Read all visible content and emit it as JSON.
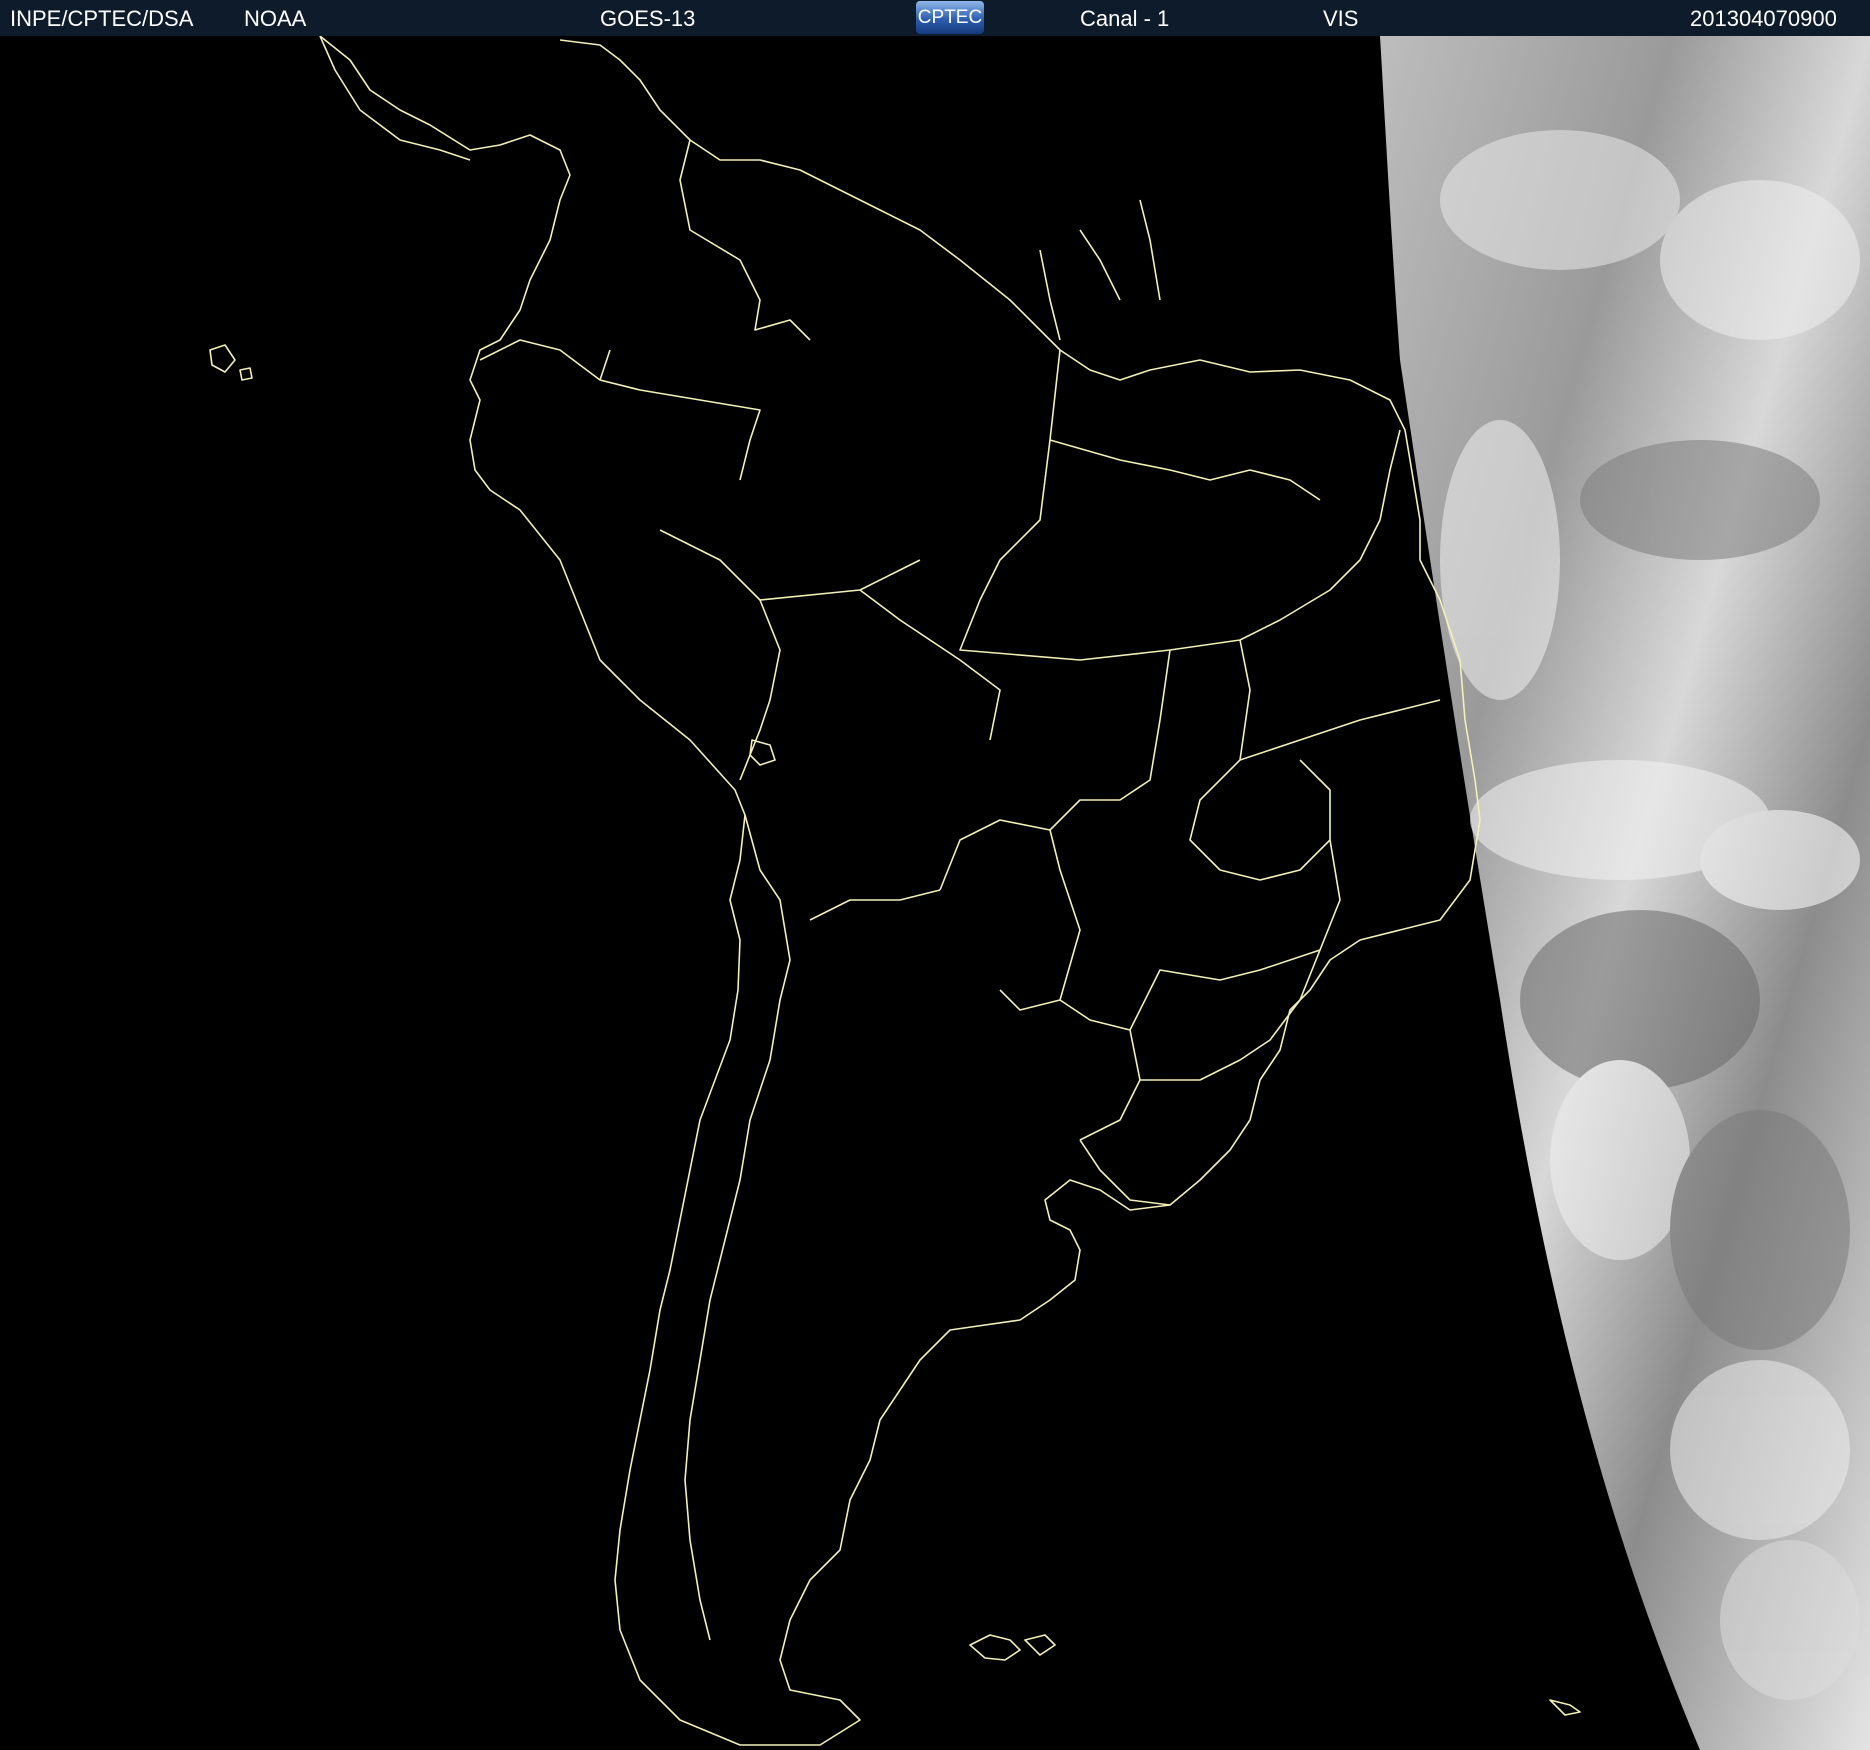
{
  "header": {
    "agency": "INPE/CPTEC/DSA",
    "partner": "NOAA",
    "satellite": "GOES-13",
    "logo_text": "CPTEC",
    "channel": "Canal - 1",
    "band": "VIS",
    "timestamp": "201304070900"
  },
  "colors": {
    "background": "#000000",
    "header_bg": "#0d1b2a",
    "borders": "#f2f0b8",
    "cloud_light": "#e6e6e6",
    "cloud_dark": "#6f6f6f"
  }
}
